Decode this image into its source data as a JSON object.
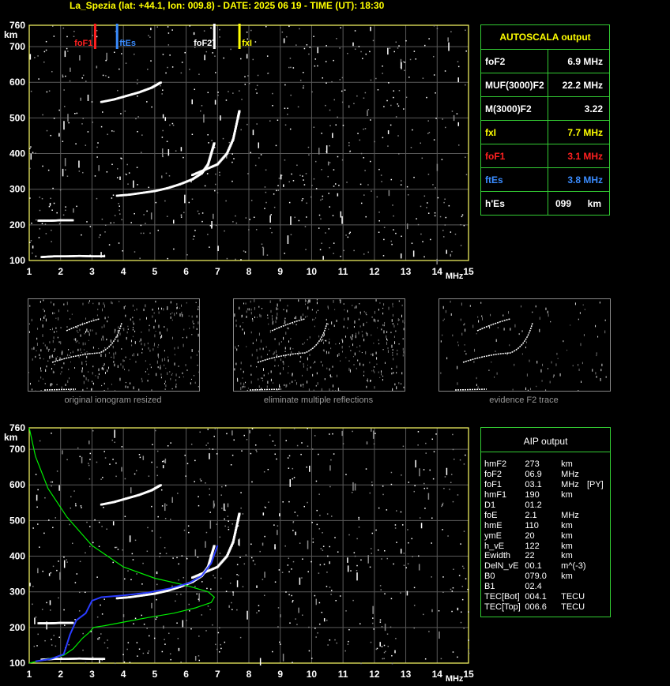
{
  "title": "La_Spezia (lat: +44.1, lon: 009.8) - DATE: 2025 06 19 - TIME (UT): 18:30",
  "axis": {
    "y_unit": "km",
    "y_ticks": [
      "760",
      "700",
      "600",
      "500",
      "400",
      "300",
      "200",
      "100"
    ],
    "x_ticks": [
      "1",
      "2",
      "3",
      "4",
      "5",
      "6",
      "7",
      "8",
      "9",
      "10",
      "11",
      "12",
      "13",
      "14",
      "15"
    ],
    "x_unit": "MHz"
  },
  "markers": {
    "foF1": {
      "label": "foF1",
      "freq": 3.1,
      "color": "#ff2020"
    },
    "ftEs": {
      "label": "ftEs",
      "freq": 3.8,
      "color": "#3a8cff"
    },
    "foF2": {
      "label": "foF2",
      "freq": 6.9,
      "color": "#ffffff"
    },
    "fxI": {
      "label": "fxI",
      "freq": 7.7,
      "color": "#ffff00"
    }
  },
  "autoscala": {
    "title": "AUTOSCALA output",
    "rows": [
      {
        "key": "foF2",
        "value": "6.9 MHz",
        "color": "#ffffff"
      },
      {
        "key": "MUF(3000)F2",
        "value": "22.2 MHz",
        "color": "#ffffff"
      },
      {
        "key": "M(3000)F2",
        "value": "3.22",
        "color": "#ffffff"
      },
      {
        "key": "fxI",
        "value": "7.7 MHz",
        "color": "#ffff00"
      },
      {
        "key": "foF1",
        "value": "3.1 MHz",
        "color": "#ff2020"
      },
      {
        "key": "ftEs",
        "value": "3.8 MHz",
        "color": "#3a8cff"
      },
      {
        "key": "h'Es",
        "value": "099",
        "unit": "km",
        "color": "#ffffff"
      }
    ]
  },
  "thumbnails": [
    {
      "caption": "original ionogram resized"
    },
    {
      "caption": "eliminate multiple reflections"
    },
    {
      "caption": "evidence F2 trace"
    }
  ],
  "aip": {
    "title": "AIP output",
    "rows": [
      [
        "hmF2",
        "273",
        "km",
        ""
      ],
      [
        "foF2",
        "06.9",
        "MHz",
        ""
      ],
      [
        "foF1",
        "03.1",
        "MHz",
        "[PY]"
      ],
      [
        "hmF1",
        "190",
        "km",
        ""
      ],
      [
        "D1",
        "01.2",
        "",
        ""
      ],
      [
        "foE",
        "2.1",
        "MHz",
        ""
      ],
      [
        "hmE",
        "110",
        "km",
        ""
      ],
      [
        "ymE",
        "20",
        "km",
        ""
      ],
      [
        "h_vE",
        "122",
        "km",
        ""
      ],
      [
        "Ewidth",
        "22",
        "km",
        ""
      ],
      [
        "DelN_vE",
        "00.1",
        "m^(-3)",
        ""
      ],
      [
        "B0",
        "079.0",
        "km",
        ""
      ],
      [
        "B1",
        "02.4",
        "",
        ""
      ],
      [
        "TEC[Bot]",
        "004.1",
        "TECU",
        ""
      ],
      [
        "TEC[Top]",
        "006.6",
        "TECU",
        ""
      ]
    ]
  },
  "chart_data": [
    {
      "type": "scatter",
      "name_text": "ionogram",
      "xlim": [
        1,
        15
      ],
      "ylim": [
        100,
        760
      ],
      "xlabel": "MHz",
      "ylabel": "km",
      "traces": {
        "Es": [
          [
            1.4,
            110
          ],
          [
            1.8,
            112
          ],
          [
            2.2,
            112
          ],
          [
            2.6,
            113
          ],
          [
            3.0,
            112
          ],
          [
            3.4,
            112
          ]
        ],
        "E2hop": [
          [
            1.3,
            212
          ],
          [
            1.7,
            212
          ],
          [
            2.0,
            213
          ],
          [
            2.4,
            213
          ]
        ],
        "F2": [
          [
            3.8,
            282
          ],
          [
            4.2,
            285
          ],
          [
            4.6,
            290
          ],
          [
            5.0,
            295
          ],
          [
            5.4,
            303
          ],
          [
            5.8,
            314
          ],
          [
            6.2,
            328
          ],
          [
            6.5,
            345
          ],
          [
            6.7,
            370
          ],
          [
            6.8,
            400
          ],
          [
            6.9,
            430
          ]
        ],
        "F2x": [
          [
            6.2,
            340
          ],
          [
            6.6,
            355
          ],
          [
            7.0,
            370
          ],
          [
            7.3,
            400
          ],
          [
            7.5,
            440
          ],
          [
            7.65,
            500
          ],
          [
            7.7,
            520
          ]
        ],
        "F2_2hop": [
          [
            3.3,
            545
          ],
          [
            3.7,
            552
          ],
          [
            4.1,
            562
          ],
          [
            4.5,
            572
          ],
          [
            4.9,
            585
          ],
          [
            5.2,
            600
          ]
        ]
      }
    },
    {
      "type": "line",
      "name_text": "AIP profile",
      "xlim": [
        1,
        15
      ],
      "ylim": [
        100,
        760
      ],
      "series": [
        {
          "name": "profile",
          "color": "#00ee00",
          "points": [
            [
              1.0,
              100
            ],
            [
              1.5,
              110
            ],
            [
              1.9,
              118
            ],
            [
              2.1,
              122
            ],
            [
              2.4,
              140
            ],
            [
              2.7,
              170
            ],
            [
              2.9,
              185
            ],
            [
              3.05,
              200
            ],
            [
              3.4,
              205
            ],
            [
              4.0,
              215
            ],
            [
              4.8,
              228
            ],
            [
              5.6,
              240
            ],
            [
              6.3,
              255
            ],
            [
              6.8,
              270
            ],
            [
              6.9,
              285
            ],
            [
              6.7,
              300
            ],
            [
              6.0,
              318
            ],
            [
              5.0,
              338
            ],
            [
              4.0,
              370
            ],
            [
              3.0,
              430
            ],
            [
              2.2,
              510
            ],
            [
              1.6,
              590
            ],
            [
              1.2,
              680
            ],
            [
              1.0,
              760
            ]
          ]
        },
        {
          "name": "virtual",
          "color": "#2a3cff",
          "points": [
            [
              1.2,
              105
            ],
            [
              1.7,
              112
            ],
            [
              2.1,
              125
            ],
            [
              2.3,
              180
            ],
            [
              2.5,
              220
            ],
            [
              2.8,
              240
            ],
            [
              3.0,
              275
            ],
            [
              3.3,
              285
            ],
            [
              4.0,
              290
            ],
            [
              4.8,
              298
            ],
            [
              5.5,
              310
            ],
            [
              6.1,
              325
            ],
            [
              6.5,
              345
            ],
            [
              6.8,
              380
            ],
            [
              7.0,
              430
            ]
          ]
        }
      ]
    }
  ]
}
